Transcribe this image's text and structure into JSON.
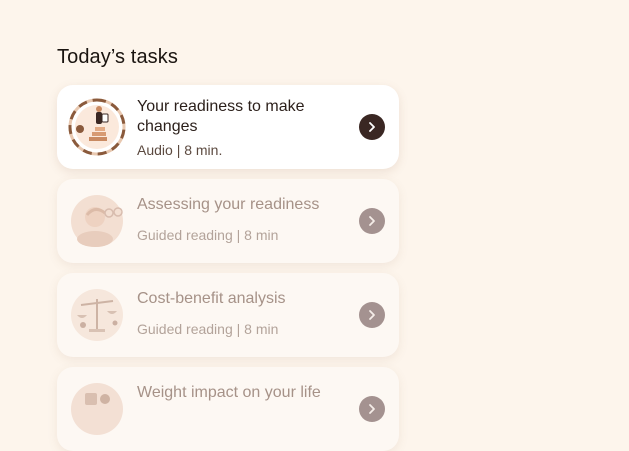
{
  "page": {
    "section_title": "Today’s tasks"
  },
  "tasks": [
    {
      "title": "Your readiness to make changes",
      "meta": "Audio | 8 min.",
      "state": "active"
    },
    {
      "title": "Assessing your readiness",
      "meta": "Guided reading | 8 min",
      "state": "locked"
    },
    {
      "title": "Cost-benefit analysis",
      "meta": "Guided reading | 8 min",
      "state": "locked"
    },
    {
      "title": "Weight impact on your life",
      "meta": "",
      "state": "locked"
    }
  ],
  "icons": {
    "go": "chevron-right-icon",
    "thumb_1": "person-on-stairs-illustration",
    "thumb_2": "head-with-glasses-illustration",
    "thumb_3": "balance-scale-illustration",
    "thumb_4": "scale-illustration"
  },
  "colors": {
    "background": "#fdf5ec",
    "card": "#ffffff",
    "active_button": "#3a2723",
    "locked_button": "#a49290",
    "locked_text": "#a69288",
    "progress_ring_active": "#8a5a3c",
    "progress_ring_track": "#e8c8b0"
  }
}
